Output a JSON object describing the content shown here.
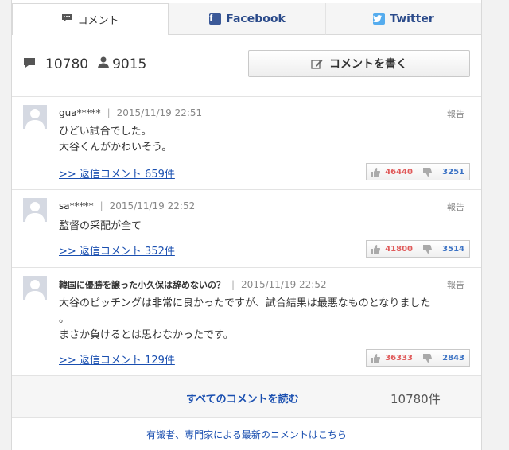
{
  "tabs": [
    {
      "label": "コメント",
      "icon": "comment-icon"
    },
    {
      "label": "Facebook",
      "icon": "facebook-icon"
    },
    {
      "label": "Twitter",
      "icon": "twitter-icon"
    }
  ],
  "stats": {
    "comment_count": "10780",
    "user_count": "9015"
  },
  "write_button": "コメントを書く",
  "comments": [
    {
      "user": "gua*****",
      "timestamp": "2015/11/19 22:51",
      "report": "報告",
      "lines": [
        "ひどい試合でした。",
        "大谷くんがかわいそう。"
      ],
      "reply": ">> 返信コメント 659件",
      "likes": "46440",
      "dislikes": "3251"
    },
    {
      "user": "sa*****",
      "timestamp": "2015/11/19 22:52",
      "report": "報告",
      "lines": [
        "監督の采配が全て"
      ],
      "reply": ">> 返信コメント 352件",
      "likes": "41800",
      "dislikes": "3514"
    },
    {
      "user": "韓国に優勝を譲った小久保は辞めないの？",
      "timestamp": "2015/11/19 22:52",
      "report": "報告",
      "lines": [
        "大谷のピッチングは非常に良かったですが、試合結果は最悪なものとなりました",
        "。",
        "まさか負けるとは思わなかったです。"
      ],
      "reply": ">> 返信コメント 129件",
      "likes": "36333",
      "dislikes": "2843"
    }
  ],
  "footer": {
    "all_comments": "すべてのコメントを読む",
    "total": "10780件",
    "expert_link": "有識者、専門家による最新のコメントはこちら"
  }
}
